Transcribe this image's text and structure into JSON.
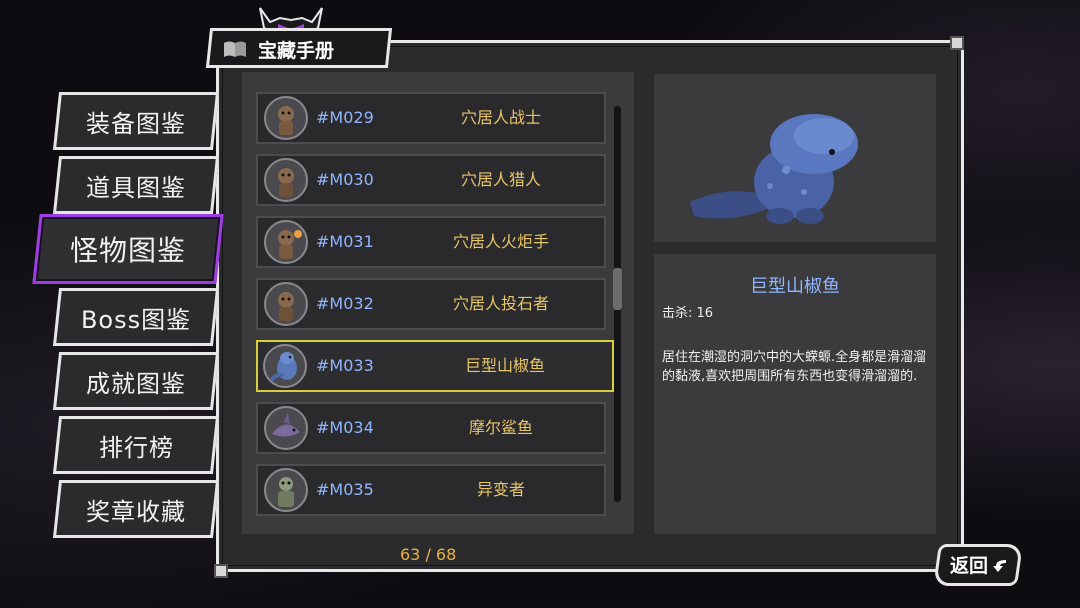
{
  "header": {
    "title": "宝藏手册",
    "icon": "book-icon"
  },
  "menu": [
    {
      "label": "装备图鉴",
      "active": false
    },
    {
      "label": "道具图鉴",
      "active": false
    },
    {
      "label": "怪物图鉴",
      "active": true
    },
    {
      "label": "Boss图鉴",
      "active": false
    },
    {
      "label": "成就图鉴",
      "active": false
    },
    {
      "label": "排行榜",
      "active": false
    },
    {
      "label": "奖章收藏",
      "active": false
    }
  ],
  "monsters": [
    {
      "code": "#M029",
      "name": "穴居人战士",
      "selected": false
    },
    {
      "code": "#M030",
      "name": "穴居人猎人",
      "selected": false
    },
    {
      "code": "#M031",
      "name": "穴居人火炬手",
      "selected": false
    },
    {
      "code": "#M032",
      "name": "穴居人投石者",
      "selected": false
    },
    {
      "code": "#M033",
      "name": "巨型山椒鱼",
      "selected": true
    },
    {
      "code": "#M034",
      "name": "摩尔鲨鱼",
      "selected": false
    },
    {
      "code": "#M035",
      "name": "异变者",
      "selected": false
    }
  ],
  "pagination": {
    "text": "63 / 68"
  },
  "detail": {
    "name": "巨型山椒鱼",
    "kills_label": "击杀: 16",
    "description": "居住在潮湿的洞穴中的大蝾螈.全身都是滑溜溜的黏液,喜欢把周围所有东西也变得滑溜溜的."
  },
  "back_button": {
    "label": "返回"
  },
  "colors": {
    "accent_purple": "#9b3fe0",
    "code_blue": "#8fb6ff",
    "name_gold": "#e7c56a",
    "select_yellow": "#d7cf3f",
    "counter_orange": "#e8b343"
  }
}
